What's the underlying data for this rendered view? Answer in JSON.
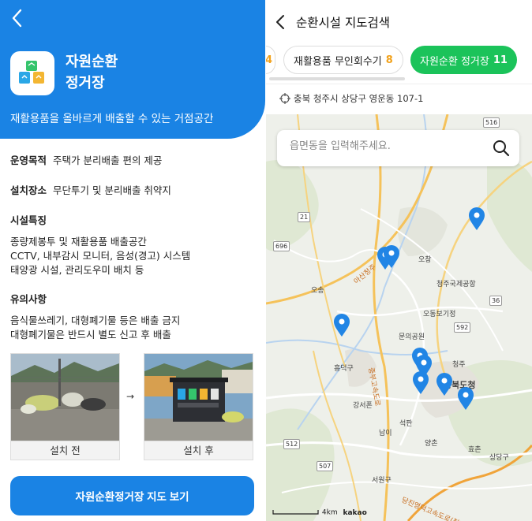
{
  "left": {
    "hero": {
      "title_line1": "자원순환",
      "title_line2": "정거장",
      "subtitle": "재활용품을 올바르게 배출할 수 있는 거점공간"
    },
    "info": {
      "purpose_label": "운영목적",
      "purpose_value": "주택가 분리배출 편의 제공",
      "location_label": "설치장소",
      "location_value": "무단투기 및 분리배출 취약지",
      "features_title": "시설특징",
      "features": [
        "종량제봉투 및 재활용품 배출공간",
        "CCTV, 내부감시 모니터, 음성(경고) 시스템",
        "태양광 시설, 관리도우미 배치 등"
      ],
      "notice_title": "유의사항",
      "notices": [
        "음식물쓰레기, 대형폐기물 등은 배출 금지",
        "대형폐기물은 반드시 별도 신고 후 배출"
      ]
    },
    "photos": {
      "before_caption": "설치 전",
      "after_caption": "설치 후",
      "arrow": "→"
    },
    "cta_label": "자원순환정거장 지도 보기"
  },
  "right": {
    "title": "순환시설 지도검색",
    "tabs": [
      {
        "label": "",
        "count": "4"
      },
      {
        "label": "재활용품 무인회수기",
        "count": "8"
      },
      {
        "label": "자원순환 정거장",
        "count": "11"
      }
    ],
    "location_text": "충북 청주시 상당구 영운동 107-1",
    "search_placeholder": "읍면동을 입력해주세요.",
    "map_labels": {
      "ochang": "오창",
      "airport": "청주국제공항",
      "osong_station": "오송",
      "osong": "오동보기정",
      "munui": "문의공원",
      "cheongju": "청주",
      "chungbuk": "충북도청",
      "heungdeok": "흥덕구",
      "gangseo": "강서폰",
      "namil": "남이",
      "seokpan": "석판",
      "yangcheon": "양촌",
      "hyochon": "효촌",
      "sangdang": "상당구",
      "seowon": "서원구",
      "hwy_name": "당진영덕고속도로(청주-상주)",
      "hwy_left": "중부고속도로",
      "hwy_osan": "아산청주",
      "r516": "516",
      "r21": "21",
      "r696": "696",
      "r36": "36",
      "r592": "592",
      "r512": "512",
      "r507": "507"
    },
    "scale_label": "4km",
    "attribution": "kakao"
  },
  "colors": {
    "primary_blue": "#1a83e4",
    "green": "#1bc35a",
    "orange_count": "#f2a21c",
    "pin_blue": "#2185e5"
  }
}
